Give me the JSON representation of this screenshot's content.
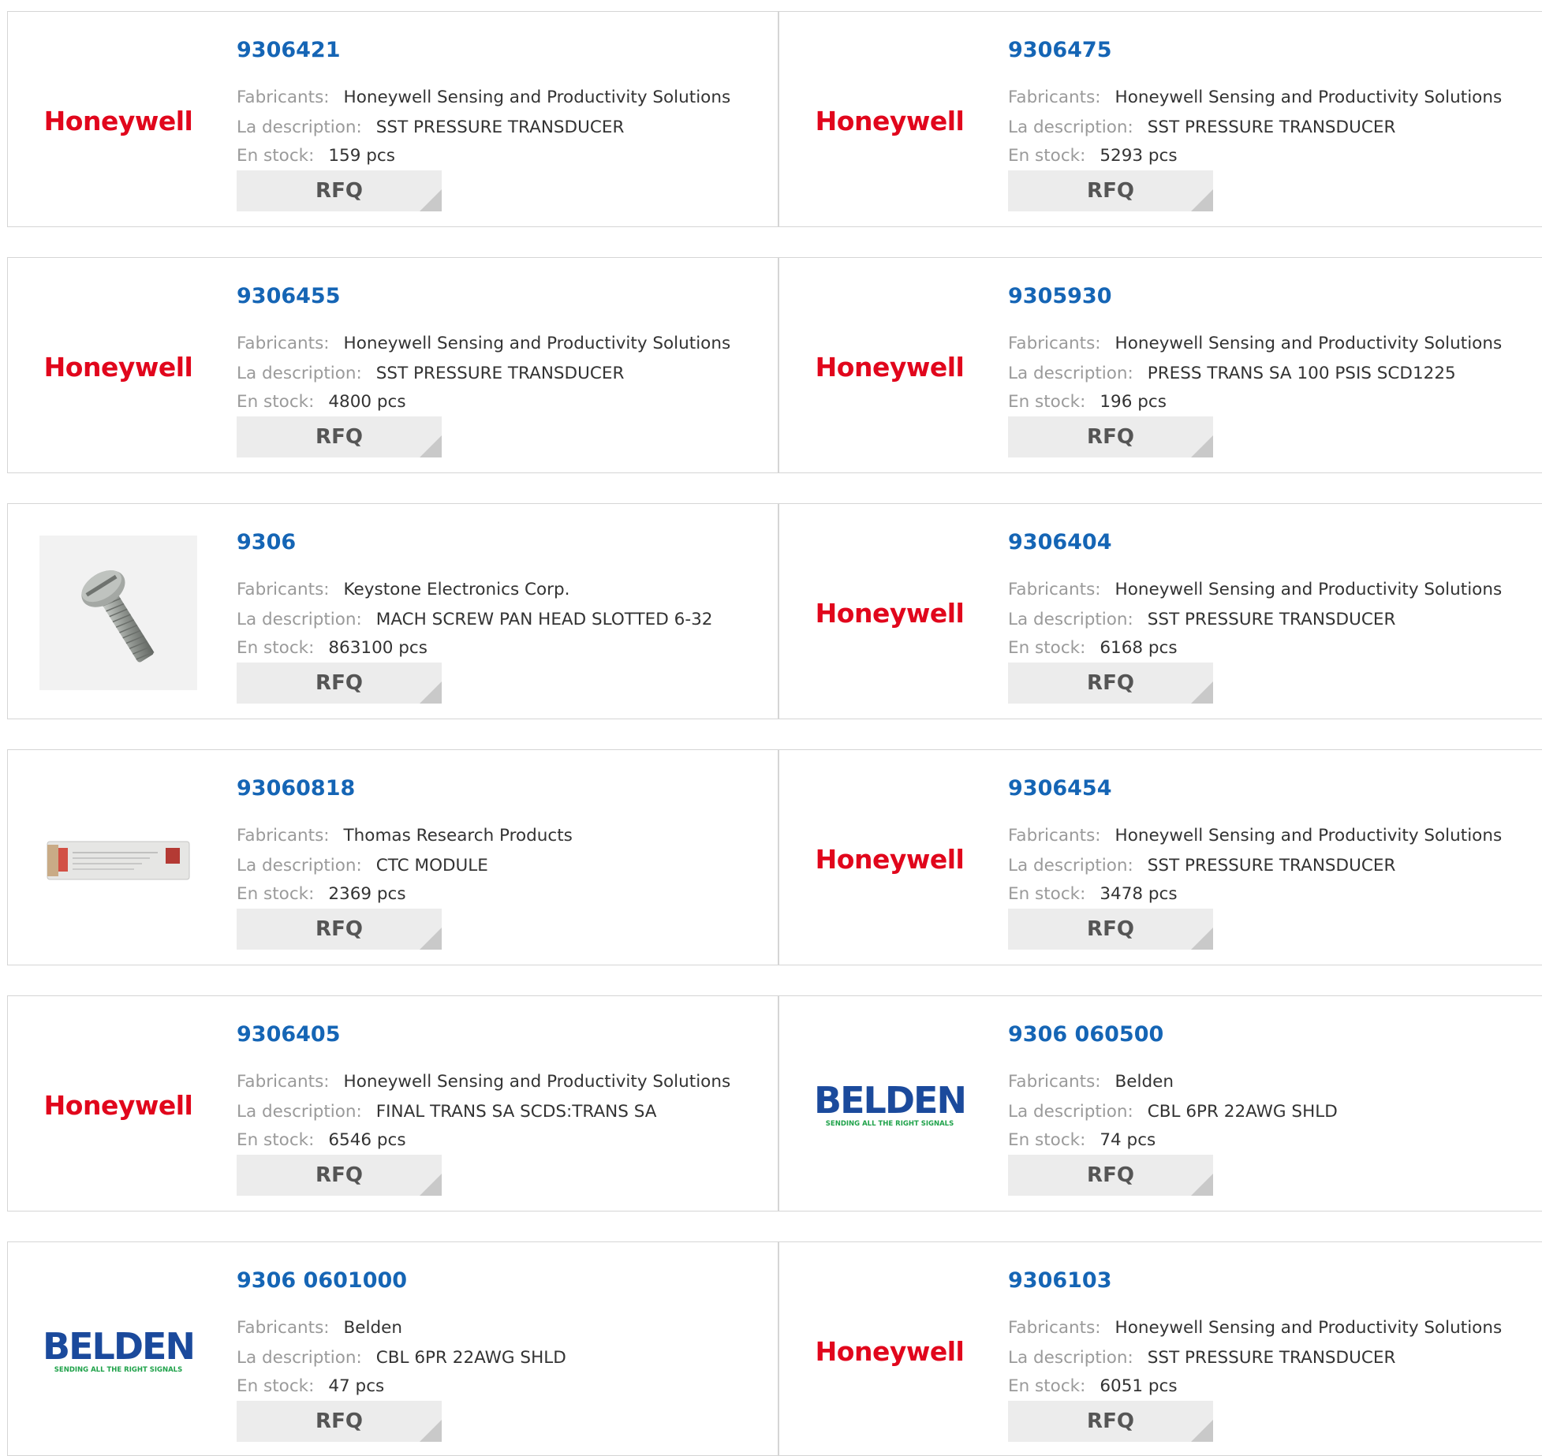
{
  "labels": {
    "manufacturer": "Fabricants:",
    "description": "La description:",
    "stock": "En stock:",
    "rfq": "RFQ"
  },
  "products": [
    {
      "part": "9306421",
      "logo": "honeywell",
      "manufacturer": "Honeywell Sensing and Productivity Solutions",
      "description": "SST PRESSURE TRANSDUCER",
      "stock": "159 pcs"
    },
    {
      "part": "9306475",
      "logo": "honeywell",
      "manufacturer": "Honeywell Sensing and Productivity Solutions",
      "description": "SST PRESSURE TRANSDUCER",
      "stock": "5293 pcs"
    },
    {
      "part": "9306455",
      "logo": "honeywell",
      "manufacturer": "Honeywell Sensing and Productivity Solutions",
      "description": "SST PRESSURE TRANSDUCER",
      "stock": "4800 pcs"
    },
    {
      "part": "9305930",
      "logo": "honeywell",
      "manufacturer": "Honeywell Sensing and Productivity Solutions",
      "description": "PRESS TRANS SA 100 PSIS SCD1225",
      "stock": "196 pcs"
    },
    {
      "part": "9306",
      "logo": "screw-photo",
      "manufacturer": "Keystone Electronics Corp.",
      "description": "MACH SCREW PAN HEAD SLOTTED 6-32",
      "stock": "863100 pcs"
    },
    {
      "part": "9306404",
      "logo": "honeywell",
      "manufacturer": "Honeywell Sensing and Productivity Solutions",
      "description": "SST PRESSURE TRANSDUCER",
      "stock": "6168 pcs"
    },
    {
      "part": "93060818",
      "logo": "module-photo",
      "manufacturer": "Thomas Research Products",
      "description": "CTC MODULE",
      "stock": "2369 pcs"
    },
    {
      "part": "9306454",
      "logo": "honeywell",
      "manufacturer": "Honeywell Sensing and Productivity Solutions",
      "description": "SST PRESSURE TRANSDUCER",
      "stock": "3478 pcs"
    },
    {
      "part": "9306405",
      "logo": "honeywell",
      "manufacturer": "Honeywell Sensing and Productivity Solutions",
      "description": "FINAL TRANS SA SCDS:TRANS SA",
      "stock": "6546 pcs"
    },
    {
      "part": "9306 060500",
      "logo": "belden",
      "manufacturer": "Belden",
      "description": "CBL 6PR 22AWG SHLD",
      "stock": "74 pcs"
    },
    {
      "part": "9306 0601000",
      "logo": "belden",
      "manufacturer": "Belden",
      "description": "CBL 6PR 22AWG SHLD",
      "stock": "47 pcs"
    },
    {
      "part": "9306103",
      "logo": "honeywell",
      "manufacturer": "Honeywell Sensing and Productivity Solutions",
      "description": "SST PRESSURE TRANSDUCER",
      "stock": "6051 pcs"
    }
  ],
  "brands": {
    "honeywell": "Honeywell",
    "belden": "BELDEN",
    "belden_tagline": "SENDING ALL THE RIGHT SIGNALS"
  },
  "colors": {
    "part_link": "#1565b5",
    "label": "#9a9a9a",
    "value": "#333333",
    "honeywell_red": "#e1061c",
    "belden_blue": "#1b4a9c",
    "belden_green": "#1fa24a",
    "rfq_bg": "#ececec",
    "border": "#d5d5d5"
  }
}
